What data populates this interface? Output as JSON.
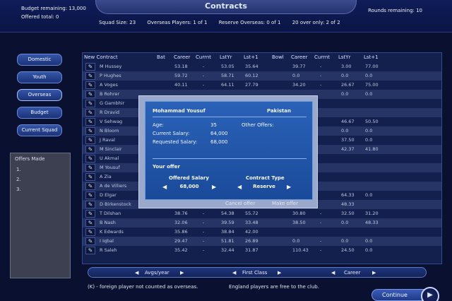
{
  "header": {
    "title": "Contracts",
    "budget_remaining": "Budget remaining: 13,000",
    "offered_total": "Offered total: 0",
    "rounds_remaining": "Rounds remaining: 10",
    "squad_size": "Squad Size: 23",
    "overseas": "Overseas Players: 1 of 1",
    "reserve_overseas": "Reserve Overseas: 0 of 1",
    "twenty_over": "20 over only: 2 of 2"
  },
  "nav": {
    "domestic": "Domestic",
    "youth": "Youth",
    "overseas": "Overseas",
    "budget": "Budget",
    "current_squad": "Current Squad"
  },
  "offers": {
    "title": "Offers Made",
    "slots": [
      "1.",
      "2.",
      "3."
    ]
  },
  "table": {
    "headers": {
      "new_contract": "New Contract",
      "bat": "Bat",
      "career": "Career",
      "currnt": "Currnt",
      "lstyr": "LstYr",
      "lst1": "Lst+1",
      "bowl": "Bowl",
      "career2": "Career",
      "currnt2": "Currnt",
      "lstyr2": "LstYr",
      "lst12": "Lst+1"
    },
    "rows": [
      {
        "name": "M Hussey",
        "bc": "53.18",
        "bcur": "-",
        "bly": "53.05",
        "bl1": "35.64",
        "wc": "39.77",
        "wcur": "-",
        "wly": "3.00",
        "wl1": "77.00"
      },
      {
        "name": "P Hughes",
        "bc": "59.72",
        "bcur": "-",
        "bly": "58.71",
        "bl1": "60.12",
        "wc": "0.0",
        "wcur": "-",
        "wly": "0.0",
        "wl1": "0.0"
      },
      {
        "name": "A Voges",
        "bc": "40.11",
        "bcur": "-",
        "bly": "64.11",
        "bl1": "27.79",
        "wc": "34.20",
        "wcur": "-",
        "wly": "26.67",
        "wl1": "75.00"
      },
      {
        "name": "B Rohrer",
        "bc": "",
        "bcur": "",
        "bly": "",
        "bl1": "",
        "wc": "",
        "wcur": "",
        "wly": "0.0",
        "wl1": "0.0"
      },
      {
        "name": "G Gambhir",
        "bc": "",
        "bcur": "",
        "bly": "",
        "bl1": "",
        "wc": "",
        "wcur": "",
        "wly": "",
        "wl1": ""
      },
      {
        "name": "R Dravid",
        "bc": "",
        "bcur": "",
        "bly": "",
        "bl1": "",
        "wc": "",
        "wcur": "",
        "wly": "",
        "wl1": ""
      },
      {
        "name": "V Sehwag",
        "bc": "",
        "bcur": "",
        "bly": "",
        "bl1": "",
        "wc": "",
        "wcur": "",
        "wly": "46.67",
        "wl1": "50.50"
      },
      {
        "name": "N Bloom",
        "bc": "",
        "bcur": "",
        "bly": "",
        "bl1": "",
        "wc": "",
        "wcur": "",
        "wly": "0.0",
        "wl1": "0.0"
      },
      {
        "name": "J Raval",
        "bc": "",
        "bcur": "",
        "bly": "",
        "bl1": "",
        "wc": "",
        "wcur": "",
        "wly": "37.50",
        "wl1": "0.0"
      },
      {
        "name": "M Sinclair",
        "bc": "",
        "bcur": "",
        "bly": "",
        "bl1": "",
        "wc": "",
        "wcur": "",
        "wly": "42.37",
        "wl1": "41.80"
      },
      {
        "name": "U Akmal",
        "bc": "",
        "bcur": "",
        "bly": "",
        "bl1": "",
        "wc": "",
        "wcur": "",
        "wly": "",
        "wl1": ""
      },
      {
        "name": "M Yousuf",
        "bc": "",
        "bcur": "",
        "bly": "",
        "bl1": "",
        "wc": "",
        "wcur": "",
        "wly": "",
        "wl1": ""
      },
      {
        "name": "A Zia",
        "bc": "",
        "bcur": "",
        "bly": "",
        "bl1": "",
        "wc": "",
        "wcur": "",
        "wly": "",
        "wl1": ""
      },
      {
        "name": "A de Villiers",
        "bc": "",
        "bcur": "",
        "bly": "",
        "bl1": "",
        "wc": "",
        "wcur": "",
        "wly": "",
        "wl1": ""
      },
      {
        "name": "D Elgar",
        "bc": "",
        "bcur": "",
        "bly": "",
        "bl1": "",
        "wc": "",
        "wcur": "",
        "wly": "64.33",
        "wl1": "0.0"
      },
      {
        "name": "D Birkenstock",
        "bc": "",
        "bcur": "",
        "bly": "",
        "bl1": "",
        "wc": "",
        "wcur": "",
        "wly": "48.33",
        "wl1": ""
      },
      {
        "name": "T Dilshan",
        "bc": "38.76",
        "bcur": "-",
        "bly": "54.38",
        "bl1": "55.72",
        "wc": "30.80",
        "wcur": "-",
        "wly": "32.50",
        "wl1": "31.20"
      },
      {
        "name": "B Nash",
        "bc": "32.06",
        "bcur": "-",
        "bly": "39.59",
        "bl1": "33.48",
        "wc": "38.50",
        "wcur": "-",
        "wly": "0.0",
        "wl1": "48.33"
      },
      {
        "name": "K Edwards",
        "bc": "35.86",
        "bcur": "-",
        "bly": "38.84",
        "bl1": "42.00",
        "wc": "",
        "wcur": "",
        "wly": "",
        "wl1": ""
      },
      {
        "name": "I Iqbal",
        "bc": "29.47",
        "bcur": "-",
        "bly": "51.81",
        "bl1": "26.89",
        "wc": "0.0",
        "wcur": "-",
        "wly": "0.0",
        "wl1": "0.0"
      },
      {
        "name": "R Saleh",
        "bc": "35.42",
        "bcur": "-",
        "bly": "32.44",
        "bl1": "31.87",
        "wc": "110.43",
        "wcur": "-",
        "wly": "24.50",
        "wl1": "0.0"
      }
    ]
  },
  "bottom_nav": {
    "avgs": "Avgs/year",
    "first_class": "First Class",
    "career": "Career"
  },
  "footer": {
    "note1": "(K) - foreign player not counted as overseas.",
    "note2": "England players are free to the club.",
    "continue": "Continue"
  },
  "modal": {
    "player_name": "Mohammad Yousuf",
    "country": "Pakistan",
    "age_label": "Age:",
    "age_value": "35",
    "current_salary_label": "Current Salary:",
    "current_salary_value": "64,000",
    "requested_salary_label": "Requested Salary:",
    "requested_salary_value": "68,000",
    "other_offers_label": "Other Offers:",
    "your_offer": "Your offer",
    "offered_salary_label": "Offered Salary",
    "offered_salary_value": "68,000",
    "contract_type_label": "Contract Type",
    "contract_type_value": "Reserve",
    "cancel_offer": "Cancel offer",
    "make_offer": "Make offer"
  }
}
